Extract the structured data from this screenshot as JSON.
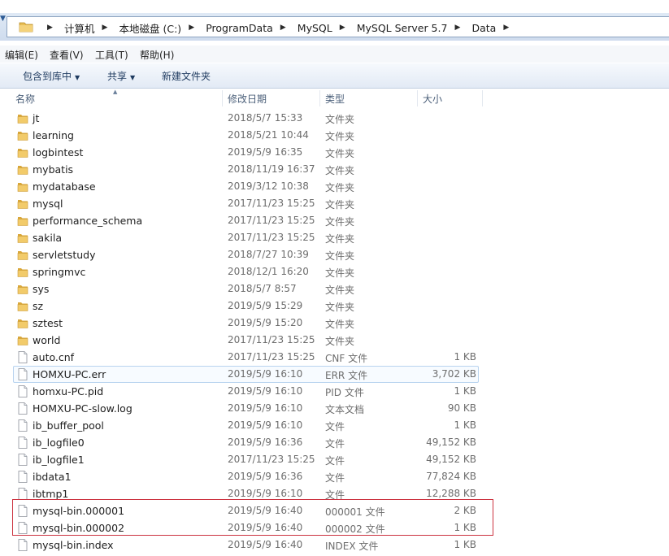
{
  "address": {
    "crumbs": [
      "计算机",
      "本地磁盘 (C:)",
      "ProgramData",
      "MySQL",
      "MySQL Server 5.7",
      "Data"
    ]
  },
  "menu": [
    "编辑(E)",
    "查看(V)",
    "工具(T)",
    "帮助(H)"
  ],
  "toolbar": {
    "include_label": "包含到库中",
    "share_label": "共享",
    "new_folder_label": "新建文件夹"
  },
  "columns": {
    "name": "名称",
    "date": "修改日期",
    "type": "类型",
    "size": "大小"
  },
  "files": [
    {
      "name": "jt",
      "date": "2018/5/7 15:33",
      "type": "文件夹",
      "size": "",
      "kind": "folder"
    },
    {
      "name": "learning",
      "date": "2018/5/21 10:44",
      "type": "文件夹",
      "size": "",
      "kind": "folder"
    },
    {
      "name": "logbintest",
      "date": "2019/5/9 16:35",
      "type": "文件夹",
      "size": "",
      "kind": "folder"
    },
    {
      "name": "mybatis",
      "date": "2018/11/19 16:37",
      "type": "文件夹",
      "size": "",
      "kind": "folder"
    },
    {
      "name": "mydatabase",
      "date": "2019/3/12 10:38",
      "type": "文件夹",
      "size": "",
      "kind": "folder"
    },
    {
      "name": "mysql",
      "date": "2017/11/23 15:25",
      "type": "文件夹",
      "size": "",
      "kind": "folder"
    },
    {
      "name": "performance_schema",
      "date": "2017/11/23 15:25",
      "type": "文件夹",
      "size": "",
      "kind": "folder"
    },
    {
      "name": "sakila",
      "date": "2017/11/23 15:25",
      "type": "文件夹",
      "size": "",
      "kind": "folder"
    },
    {
      "name": "servletstudy",
      "date": "2018/7/27 10:39",
      "type": "文件夹",
      "size": "",
      "kind": "folder"
    },
    {
      "name": "springmvc",
      "date": "2018/12/1 16:20",
      "type": "文件夹",
      "size": "",
      "kind": "folder"
    },
    {
      "name": "sys",
      "date": "2018/5/7 8:57",
      "type": "文件夹",
      "size": "",
      "kind": "folder"
    },
    {
      "name": "sz",
      "date": "2019/5/9 15:29",
      "type": "文件夹",
      "size": "",
      "kind": "folder"
    },
    {
      "name": "sztest",
      "date": "2019/5/9 15:20",
      "type": "文件夹",
      "size": "",
      "kind": "folder"
    },
    {
      "name": "world",
      "date": "2017/11/23 15:25",
      "type": "文件夹",
      "size": "",
      "kind": "folder"
    },
    {
      "name": "auto.cnf",
      "date": "2017/11/23 15:25",
      "type": "CNF 文件",
      "size": "1 KB",
      "kind": "file"
    },
    {
      "name": "HOMXU-PC.err",
      "date": "2019/5/9 16:10",
      "type": "ERR 文件",
      "size": "3,702 KB",
      "kind": "file"
    },
    {
      "name": "homxu-PC.pid",
      "date": "2019/5/9 16:10",
      "type": "PID 文件",
      "size": "1 KB",
      "kind": "file"
    },
    {
      "name": "HOMXU-PC-slow.log",
      "date": "2019/5/9 16:10",
      "type": "文本文档",
      "size": "90 KB",
      "kind": "file"
    },
    {
      "name": "ib_buffer_pool",
      "date": "2019/5/9 16:10",
      "type": "文件",
      "size": "1 KB",
      "kind": "file"
    },
    {
      "name": "ib_logfile0",
      "date": "2019/5/9 16:36",
      "type": "文件",
      "size": "49,152 KB",
      "kind": "file"
    },
    {
      "name": "ib_logfile1",
      "date": "2017/11/23 15:25",
      "type": "文件",
      "size": "49,152 KB",
      "kind": "file"
    },
    {
      "name": "ibdata1",
      "date": "2019/5/9 16:36",
      "type": "文件",
      "size": "77,824 KB",
      "kind": "file"
    },
    {
      "name": "ibtmp1",
      "date": "2019/5/9 16:10",
      "type": "文件",
      "size": "12,288 KB",
      "kind": "file"
    },
    {
      "name": "mysql-bin.000001",
      "date": "2019/5/9 16:40",
      "type": "000001 文件",
      "size": "2 KB",
      "kind": "file"
    },
    {
      "name": "mysql-bin.000002",
      "date": "2019/5/9 16:40",
      "type": "000002 文件",
      "size": "1 KB",
      "kind": "file"
    },
    {
      "name": "mysql-bin.index",
      "date": "2019/5/9 16:40",
      "type": "INDEX 文件",
      "size": "1 KB",
      "kind": "file"
    }
  ],
  "colors": {
    "folder": "#e7b94a",
    "highlight_border": "#cc3340",
    "hover_border": "#b8d3ef"
  }
}
